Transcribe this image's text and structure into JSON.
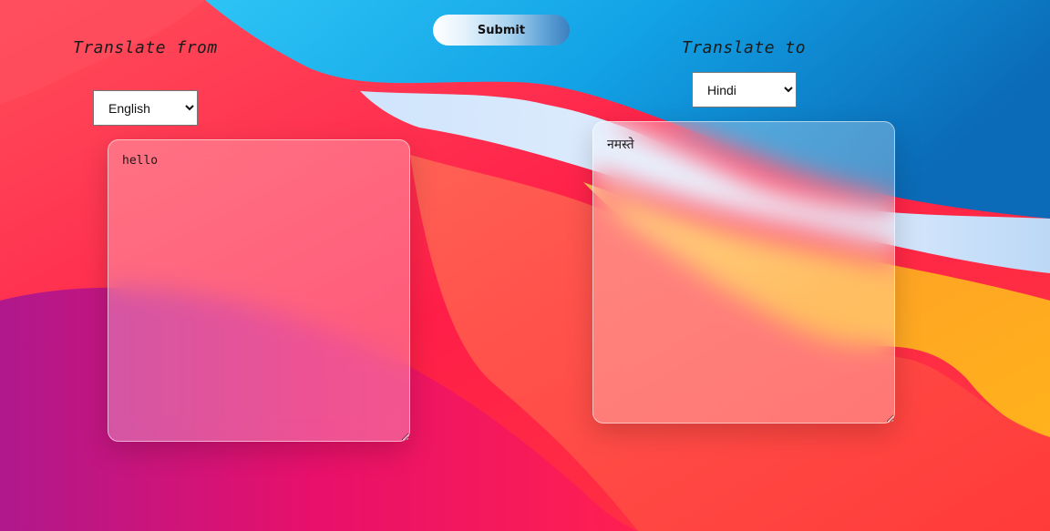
{
  "translate_from": {
    "heading": "Translate from",
    "selected_language": "English",
    "text": "hello"
  },
  "translate_to": {
    "heading": "Translate to",
    "selected_language": "Hindi",
    "text": "नमस्ते"
  },
  "submit_label": "Submit",
  "colors": {
    "wallpaper_red": "#ff2a4a",
    "wallpaper_blue": "#1a9de0",
    "wallpaper_orange": "#ffa020",
    "wallpaper_magenta": "#c4108a"
  }
}
